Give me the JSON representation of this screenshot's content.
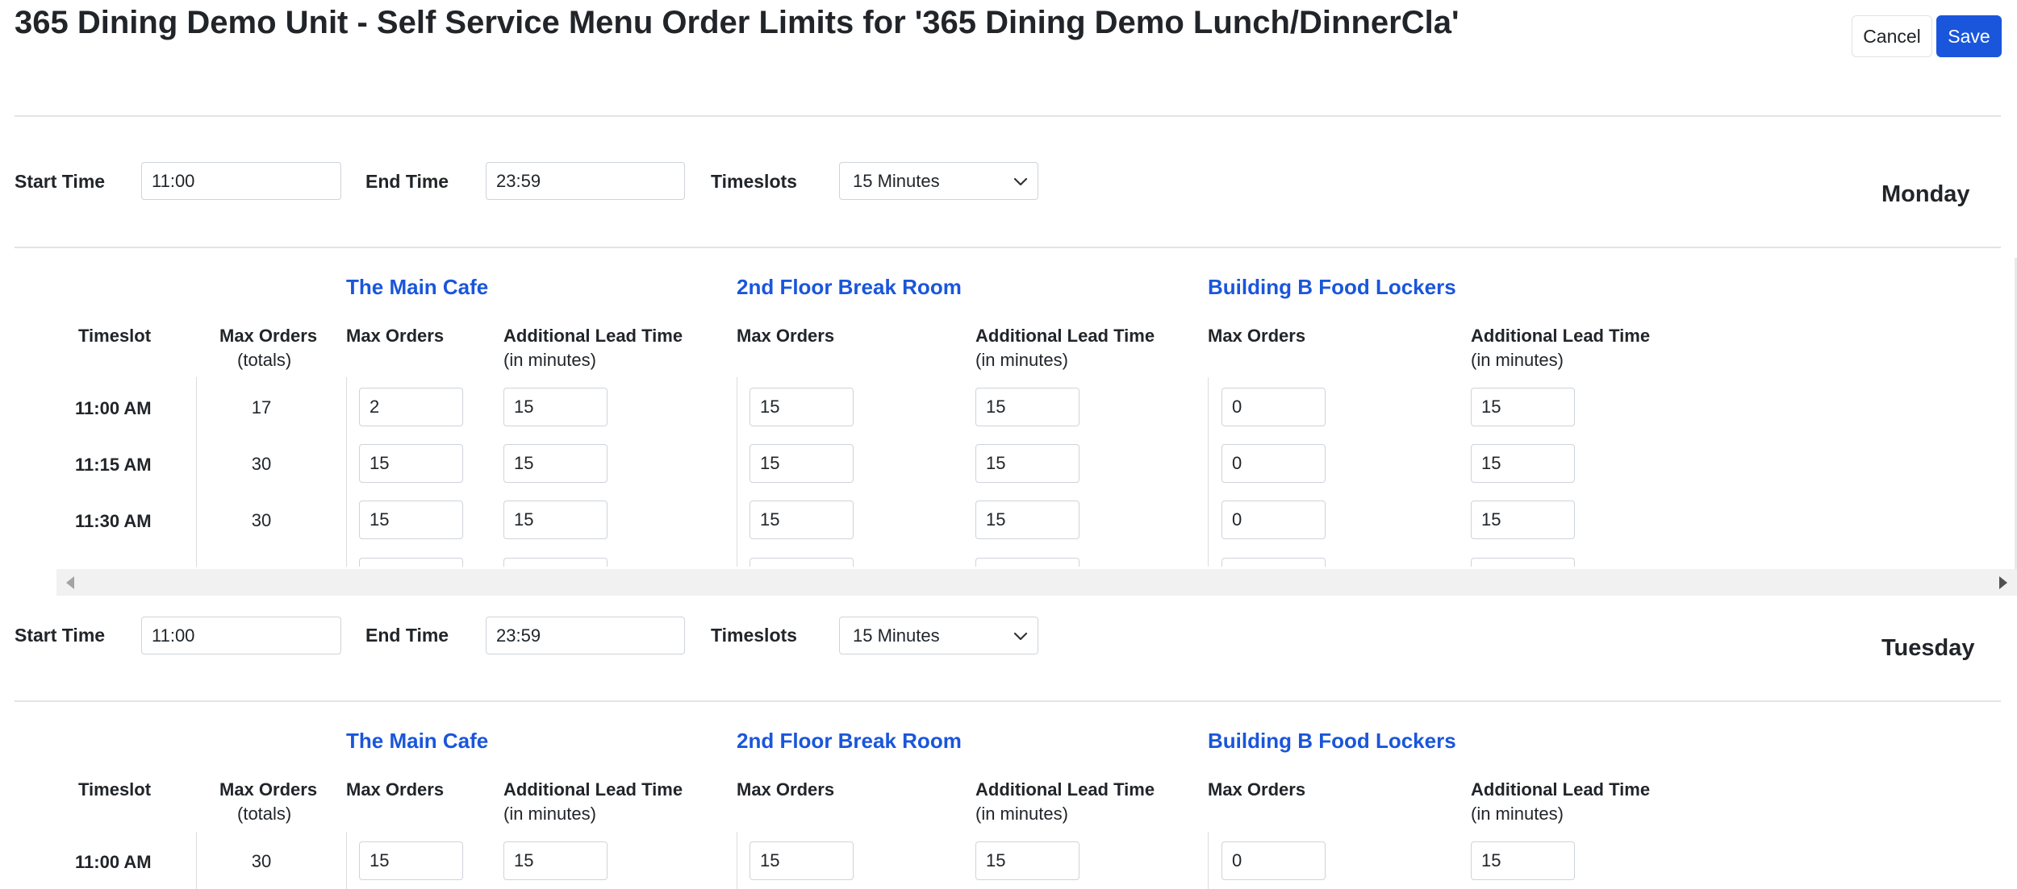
{
  "header": {
    "title": "365 Dining Demo Unit - Self Service Menu Order Limits for '365 Dining Demo Lunch/DinnerCla'",
    "cancel_label": "Cancel",
    "save_label": "Save"
  },
  "colors": {
    "accent": "#1a56db",
    "border": "#ced4da",
    "divider": "#e3e3e3",
    "scroll_track": "#f1f1f1"
  },
  "labels": {
    "start_time": "Start Time",
    "end_time": "End Time",
    "timeslots": "Timeslots",
    "timeslot": "Timeslot",
    "max_orders": "Max Orders",
    "totals": "(totals)",
    "additional_lead_time": "Additional Lead Time",
    "in_minutes": "(in minutes)"
  },
  "locations": [
    "The Main Cafe",
    "2nd Floor Break Room",
    "Building B Food Lockers"
  ],
  "days": [
    {
      "name": "Monday",
      "start_time": "11:00",
      "end_time": "23:59",
      "timeslot_option": "15 Minutes",
      "rows": [
        {
          "time": "11:00 AM",
          "total": "17",
          "cells": [
            "2",
            "15",
            "15",
            "15",
            "0",
            "15"
          ]
        },
        {
          "time": "11:15 AM",
          "total": "30",
          "cells": [
            "15",
            "15",
            "15",
            "15",
            "0",
            "15"
          ]
        },
        {
          "time": "11:30 AM",
          "total": "30",
          "cells": [
            "15",
            "15",
            "15",
            "15",
            "0",
            "15"
          ]
        }
      ]
    },
    {
      "name": "Tuesday",
      "start_time": "11:00",
      "end_time": "23:59",
      "timeslot_option": "15 Minutes",
      "rows": [
        {
          "time": "11:00 AM",
          "total": "30",
          "cells": [
            "15",
            "15",
            "15",
            "15",
            "0",
            "15"
          ]
        }
      ]
    }
  ]
}
